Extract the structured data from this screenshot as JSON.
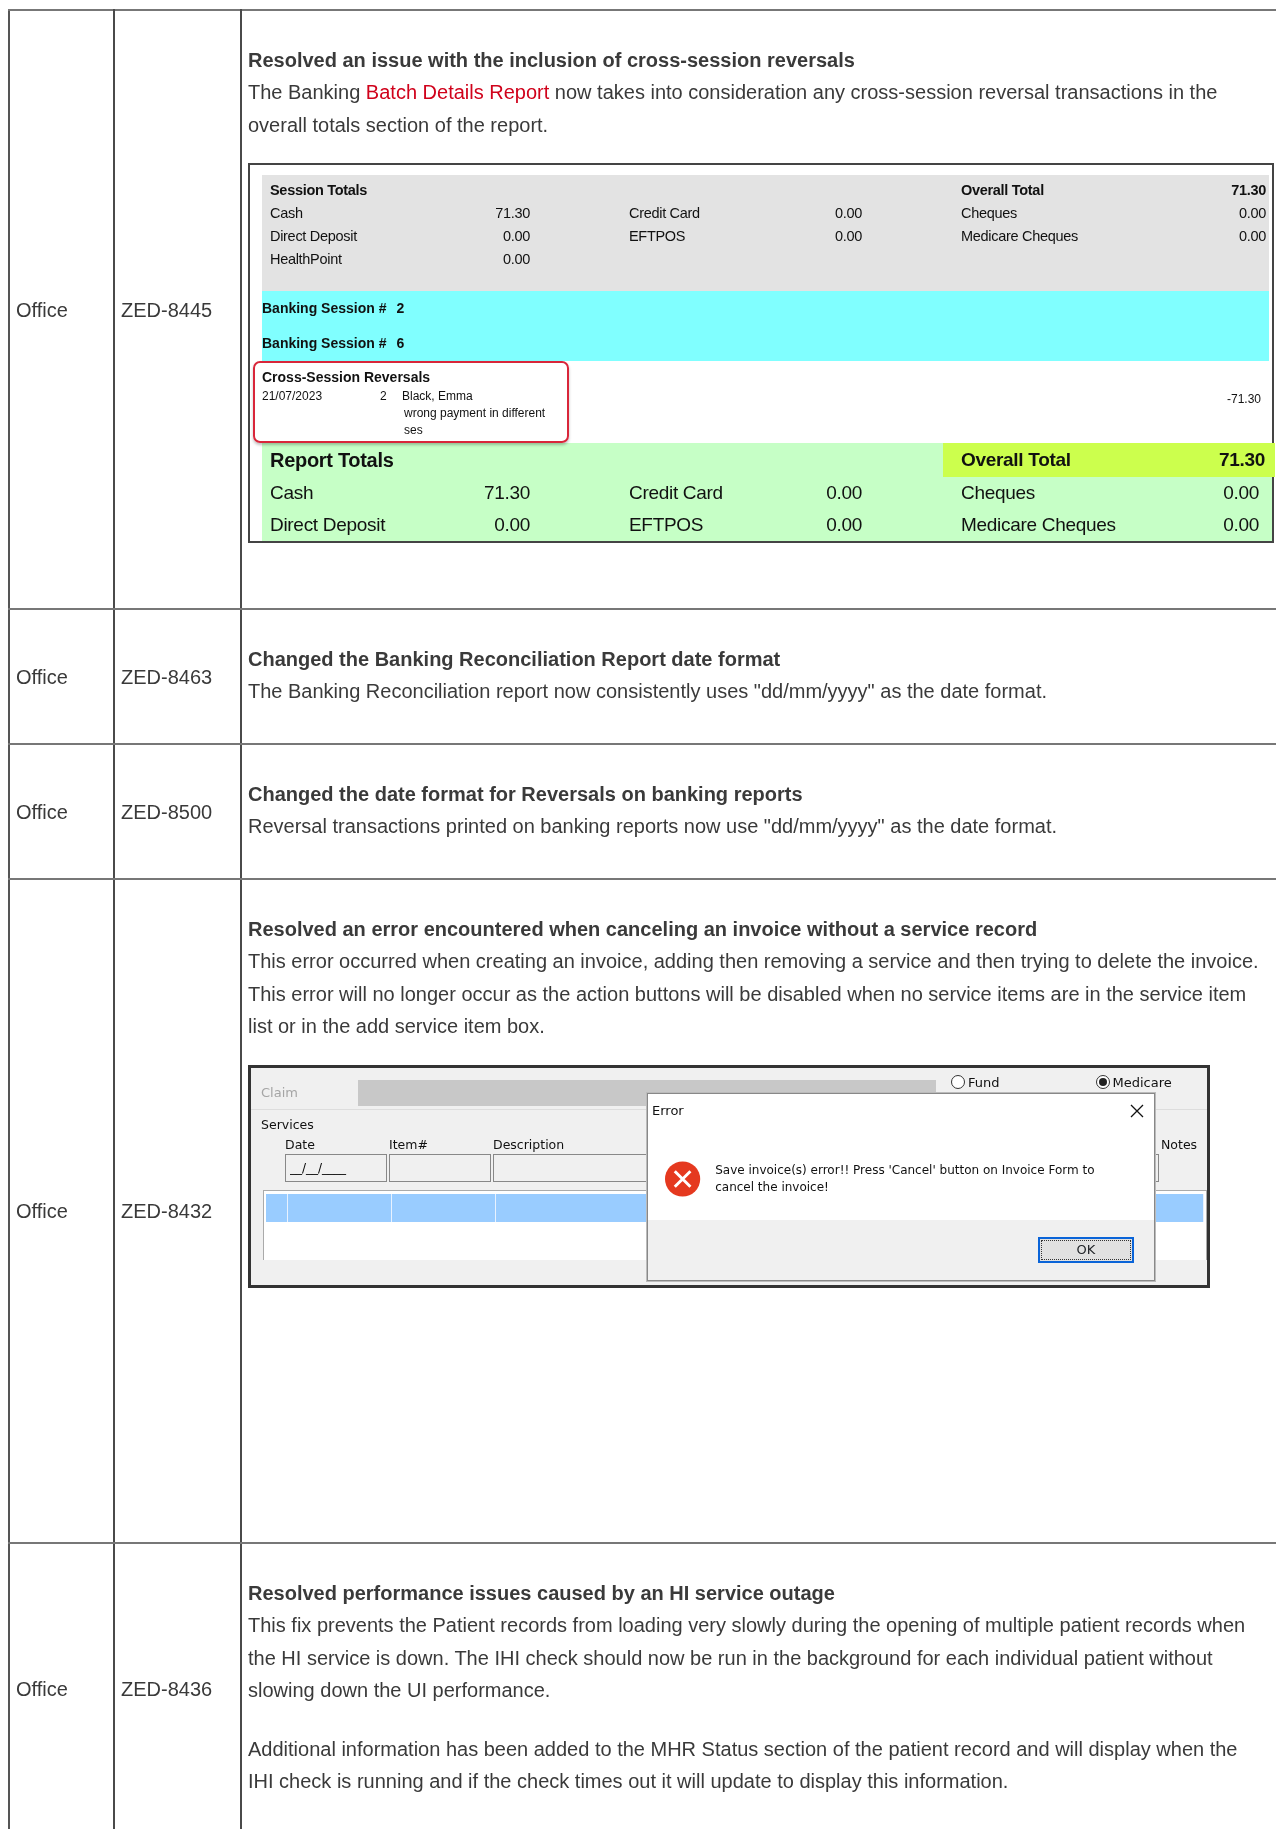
{
  "rows": [
    {
      "area": "Office",
      "ticket": "ZED-8445",
      "title": "Resolved an issue with the inclusion of cross-session reversals",
      "paragraphs": [
        [
          {
            "text": "The Banking "
          },
          {
            "text": "Batch Details Report",
            "kind": "link"
          },
          {
            "text": " now takes into consideration any cross-session reversal transactions in the overall totals section of the report."
          }
        ]
      ],
      "figure": {
        "kind": "banking_report",
        "session_totals": {
          "title": "Session Totals",
          "overall": {
            "label": "Overall Total",
            "value": "71.30",
            "highlighted": false
          },
          "items": [
            {
              "label": "Cash",
              "value": "71.30"
            },
            {
              "label": "Credit Card",
              "value": "0.00"
            },
            {
              "label": "Cheques",
              "value": "0.00"
            },
            {
              "label": "Direct Deposit",
              "value": "0.00"
            },
            {
              "label": "EFTPOS",
              "value": "0.00"
            },
            {
              "label": "Medicare Cheques",
              "value": "0.00"
            },
            {
              "label": "HealthPoint",
              "value": "0.00"
            }
          ]
        },
        "banking_sessions": [
          {
            "label": "Banking Session #",
            "number": "2"
          },
          {
            "label": "Banking Session #",
            "number": "6"
          }
        ],
        "reversals": {
          "title": "Cross-Session Reversals",
          "entries": [
            {
              "date": "21/07/2023",
              "session": "2",
              "patient": "Black, Emma",
              "note": "wrong payment in different ses",
              "amount": "-71.30"
            }
          ]
        },
        "report_totals": {
          "title": "Report Totals",
          "overall": {
            "label": "Overall Total",
            "value": "71.30",
            "highlighted": true
          },
          "items": [
            {
              "label": "Cash",
              "value": "71.30"
            },
            {
              "label": "Credit Card",
              "value": "0.00"
            },
            {
              "label": "Cheques",
              "value": "0.00"
            },
            {
              "label": "Direct Deposit",
              "value": "0.00"
            },
            {
              "label": "EFTPOS",
              "value": "0.00"
            },
            {
              "label": "Medicare Cheques",
              "value": "0.00"
            }
          ]
        }
      }
    },
    {
      "area": "Office",
      "ticket": "ZED-8463",
      "title": "Changed the Banking Reconciliation Report date format",
      "paragraphs": [
        [
          {
            "text": "The Banking Reconciliation report now consistently uses \"dd/mm/yyyy\" as the date format."
          }
        ]
      ]
    },
    {
      "area": "Office",
      "ticket": "ZED-8500",
      "title": "Changed the date format for Reversals on banking reports",
      "paragraphs": [
        [
          {
            "text": "Reversal transactions printed on banking reports now use \"dd/mm/yyyy\" as the date format."
          }
        ]
      ]
    },
    {
      "area": "Office",
      "ticket": "ZED-8432",
      "title": "Resolved an error encountered when canceling an invoice without a service record",
      "paragraphs": [
        [
          {
            "text": "This error occurred when creating an invoice, adding then removing a service and then trying to delete the invoice. This error will no longer occur as the action buttons will be disabled when no service items are in the service item list or in the add service item box."
          }
        ]
      ],
      "figure": {
        "kind": "invoice_error",
        "claim": {
          "label": "Claim",
          "disabled": true
        },
        "radios": [
          {
            "label": "Fund",
            "selected": false
          },
          {
            "label": "Medicare",
            "selected": true
          }
        ],
        "group_label": "Services",
        "columns": [
          "Date",
          "Item#",
          "Description",
          "Notes"
        ],
        "date_value": "__/__/____",
        "grid_rows": [
          {
            "selected": true
          }
        ],
        "dialog": {
          "title": "Error",
          "message": "Save invoice(s) error!! Press 'Cancel' button on Invoice Form to cancel the invoice!",
          "button": "OK"
        }
      }
    },
    {
      "area": "Office",
      "ticket": "ZED-8436",
      "title": "Resolved performance issues caused by an HI service outage",
      "paragraphs": [
        [
          {
            "text": "This fix prevents the Patient records from loading very slowly during the opening of multiple patient records when the HI service is down. The IHI check should now be run in the background for each individual patient without slowing down the UI performance."
          }
        ],
        [
          {
            "text": "Additional information has been added to the MHR Status section of the patient record and will display when the IHI check is running and if the check times out it will update to display this information."
          }
        ]
      ]
    }
  ]
}
